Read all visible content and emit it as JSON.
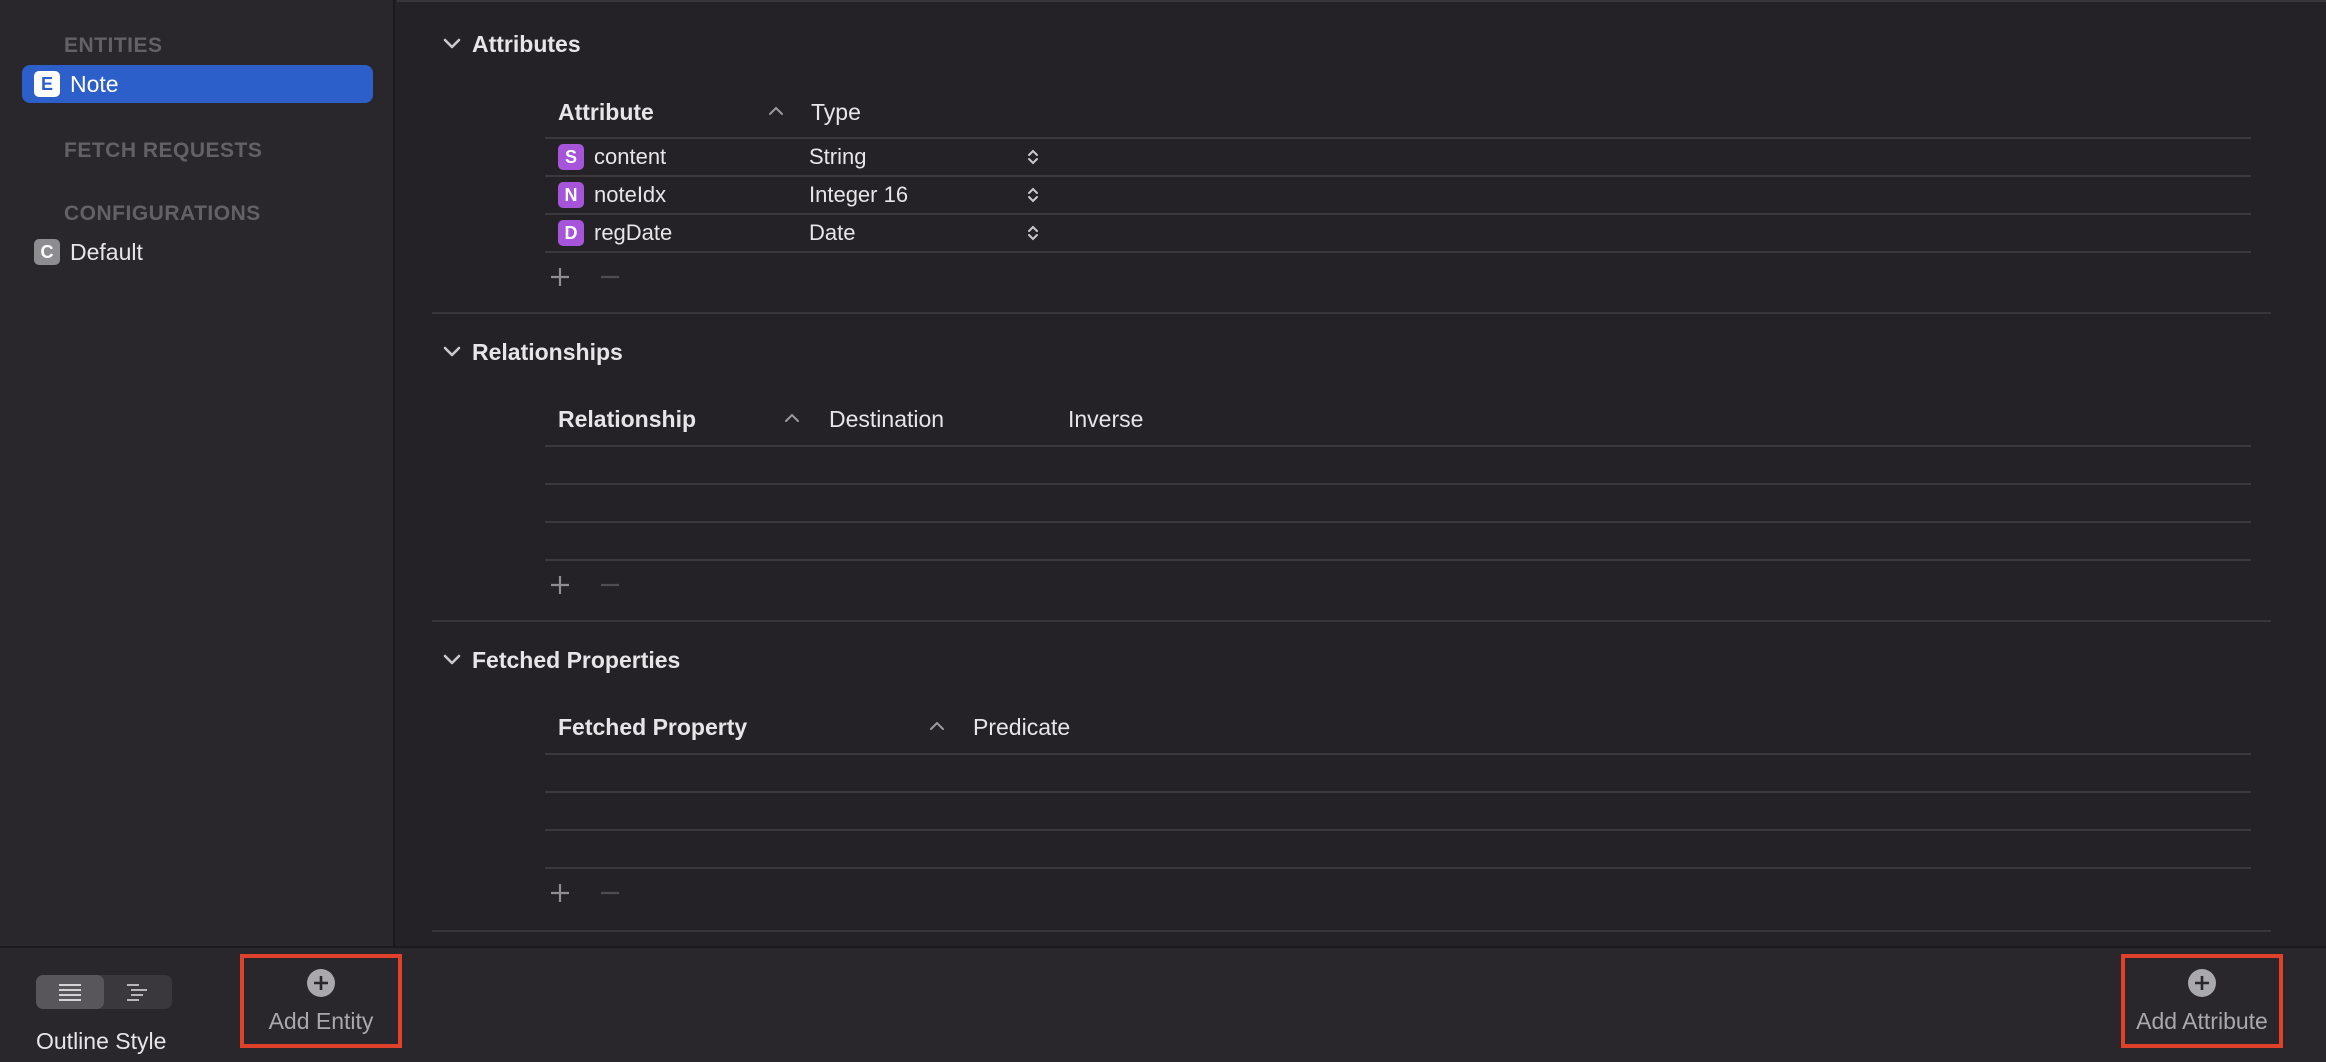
{
  "sidebar": {
    "entities_header": "ENTITIES",
    "entities": [
      {
        "badge": "E",
        "label": "Note",
        "selected": true
      }
    ],
    "fetch_requests_header": "FETCH REQUESTS",
    "configurations_header": "CONFIGURATIONS",
    "configurations": [
      {
        "badge": "C",
        "label": "Default"
      }
    ]
  },
  "attributes": {
    "title": "Attributes",
    "columns": [
      "Attribute",
      "Type"
    ],
    "rows": [
      {
        "badge": "S",
        "name": "content",
        "type": "String"
      },
      {
        "badge": "N",
        "name": "noteIdx",
        "type": "Integer 16"
      },
      {
        "badge": "D",
        "name": "regDate",
        "type": "Date"
      }
    ]
  },
  "relationships": {
    "title": "Relationships",
    "columns": [
      "Relationship",
      "Destination",
      "Inverse"
    ]
  },
  "fetched_properties": {
    "title": "Fetched Properties",
    "columns": [
      "Fetched Property",
      "Predicate"
    ]
  },
  "bottom": {
    "outline_style_label": "Outline Style",
    "add_entity_label": "Add Entity",
    "add_attribute_label": "Add Attribute"
  },
  "colors": {
    "selection": "#2c5fc9",
    "attribute_badge": "#a655db",
    "highlight_box": "#e0412a"
  }
}
